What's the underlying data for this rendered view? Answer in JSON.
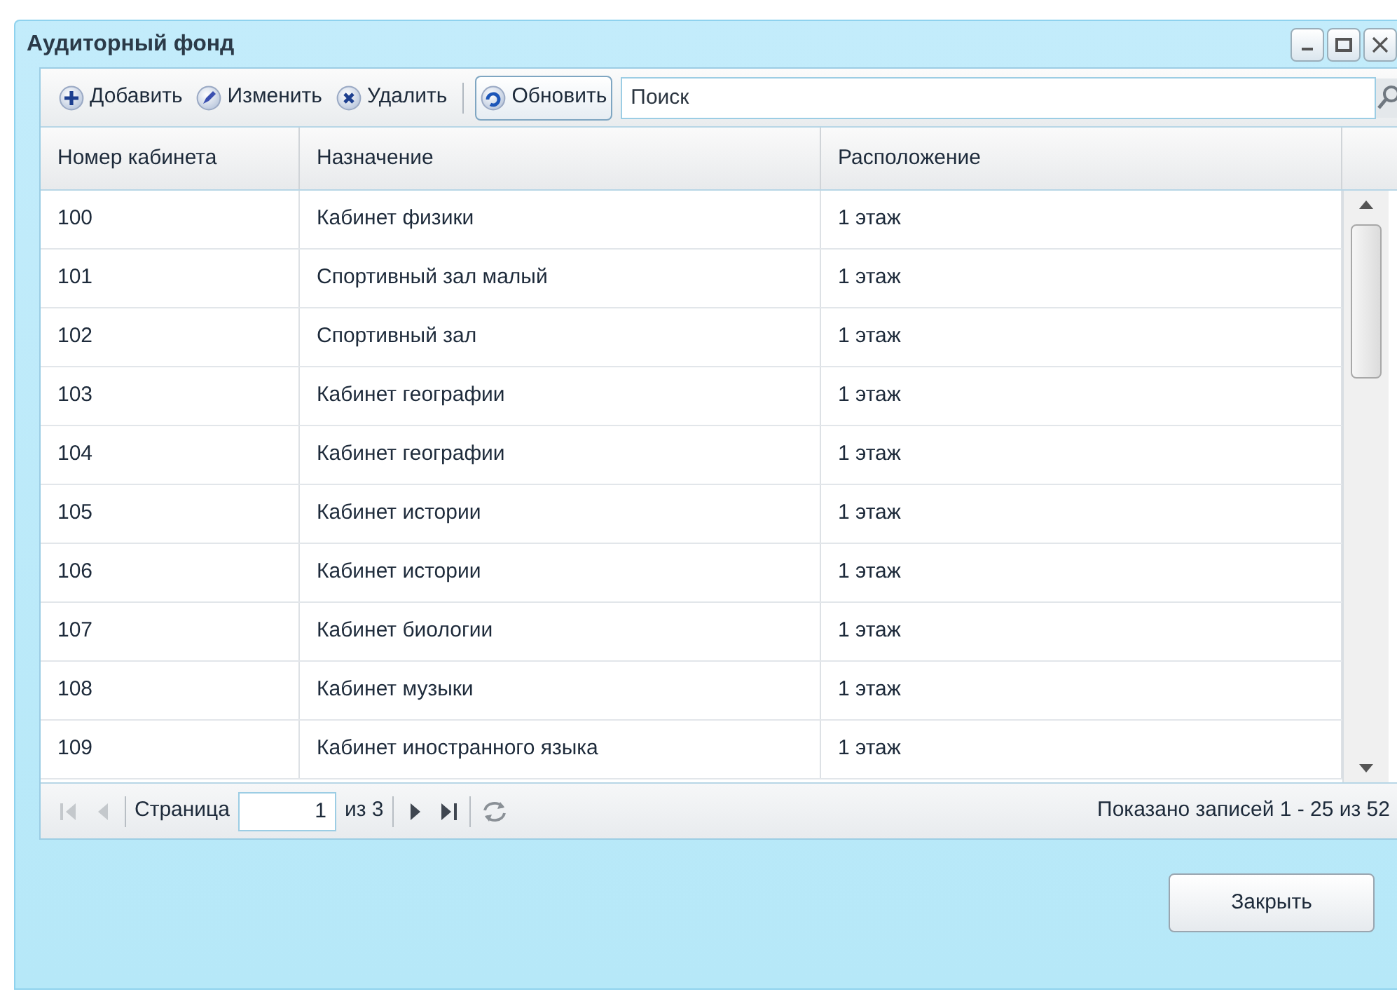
{
  "window": {
    "title": "Аудиторный фонд"
  },
  "toolbar": {
    "buttons": [
      {
        "label": "Добавить",
        "kind": "add"
      },
      {
        "label": "Изменить",
        "kind": "edit"
      },
      {
        "label": "Удалить",
        "kind": "delete"
      },
      {
        "label": "Обновить",
        "kind": "refresh"
      }
    ],
    "search": {
      "placeholder": "Поиск"
    }
  },
  "table": {
    "columns": [
      "Номер кабинета",
      "Назначение",
      "Расположение"
    ],
    "rows": [
      [
        "100",
        "Кабинет физики",
        "1 этаж"
      ],
      [
        "101",
        "Спортивный зал малый",
        "1 этаж"
      ],
      [
        "102",
        "Спортивный зал",
        "1 этаж"
      ],
      [
        "103",
        "Кабинет географии",
        "1 этаж"
      ],
      [
        "104",
        "Кабинет географии",
        "1 этаж"
      ],
      [
        "105",
        "Кабинет истории",
        "1 этаж"
      ],
      [
        "106",
        "Кабинет истории",
        "1 этаж"
      ],
      [
        "107",
        "Кабинет биологии",
        "1 этаж"
      ],
      [
        "108",
        "Кабинет музыки",
        "1 этаж"
      ],
      [
        "109",
        "Кабинет иностранного языка",
        "1 этаж"
      ]
    ]
  },
  "pager": {
    "first_disabled": true,
    "prev_disabled": true,
    "next_disabled": false,
    "last_disabled": false,
    "page_label": "Страница",
    "page": "1",
    "of_total": "из 3",
    "summary": "Показано записей 1 - 25 из 52"
  },
  "footer": {
    "close_button": "Закрыть"
  }
}
